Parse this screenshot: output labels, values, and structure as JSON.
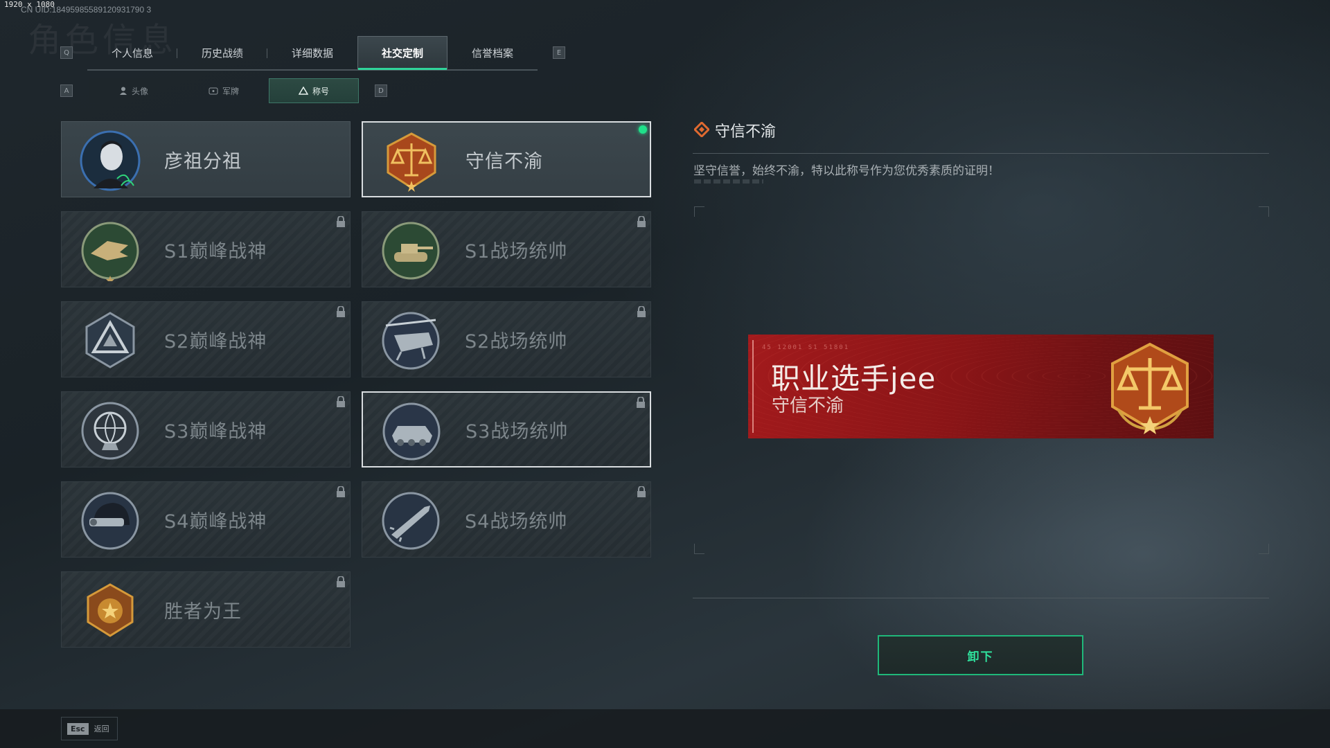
{
  "meta": {
    "dimensions": "1920 x 1080",
    "uid": "CN UID:18495985589120931790 3",
    "bg_title": "角色信息"
  },
  "nav": {
    "prev_key": "Q",
    "next_key": "E",
    "tabs": [
      {
        "label": "个人信息",
        "active": false
      },
      {
        "label": "历史战绩",
        "active": false
      },
      {
        "label": "详细数据",
        "active": false
      },
      {
        "label": "社交定制",
        "active": true
      },
      {
        "label": "信誉档案",
        "active": false
      }
    ]
  },
  "subnav": {
    "prev_key": "A",
    "next_key": "D",
    "tabs": [
      {
        "label": "头像",
        "icon": "person-icon",
        "active": false
      },
      {
        "label": "军牌",
        "icon": "tag-icon",
        "active": false
      },
      {
        "label": "称号",
        "icon": "triangle-icon",
        "active": true
      }
    ]
  },
  "titles": [
    {
      "name": "彦祖分祖",
      "emblem": "portrait-emblem",
      "locked": false,
      "equipped": false
    },
    {
      "name": "守信不渝",
      "emblem": "scales-emblem",
      "locked": false,
      "equipped": true
    },
    {
      "name": "S1巅峰战神",
      "emblem": "crocodile-emblem",
      "locked": true
    },
    {
      "name": "S1战场统帅",
      "emblem": "tank-emblem",
      "locked": true
    },
    {
      "name": "S2巅峰战神",
      "emblem": "pyramid-emblem",
      "locked": true
    },
    {
      "name": "S2战场统帅",
      "emblem": "helicopter-emblem",
      "locked": true
    },
    {
      "name": "S3巅峰战神",
      "emblem": "globe-emblem",
      "locked": true
    },
    {
      "name": "S3战场统帅",
      "emblem": "apc-emblem",
      "locked": true,
      "focused": true
    },
    {
      "name": "S4巅峰战神",
      "emblem": "helmet-emblem",
      "locked": true
    },
    {
      "name": "S4战场统帅",
      "emblem": "missile-emblem",
      "locked": true
    },
    {
      "name": "胜者为王",
      "emblem": "medal-emblem",
      "locked": true
    }
  ],
  "detail": {
    "title": "守信不渝",
    "description": "坚守信誉，始终不渝，特以此称号作为您优秀素质的证明！",
    "banner": {
      "code": "45 12001   S1 51801",
      "player_name": "职业选手jee",
      "title": "守信不渝"
    },
    "unequip_label": "卸下"
  },
  "footer": {
    "esc_key": "Esc",
    "esc_label": "返回"
  },
  "colors": {
    "accent": "#2fd49a",
    "banner_red": "#a21a1c",
    "equipped_dot": "#20e08a"
  }
}
